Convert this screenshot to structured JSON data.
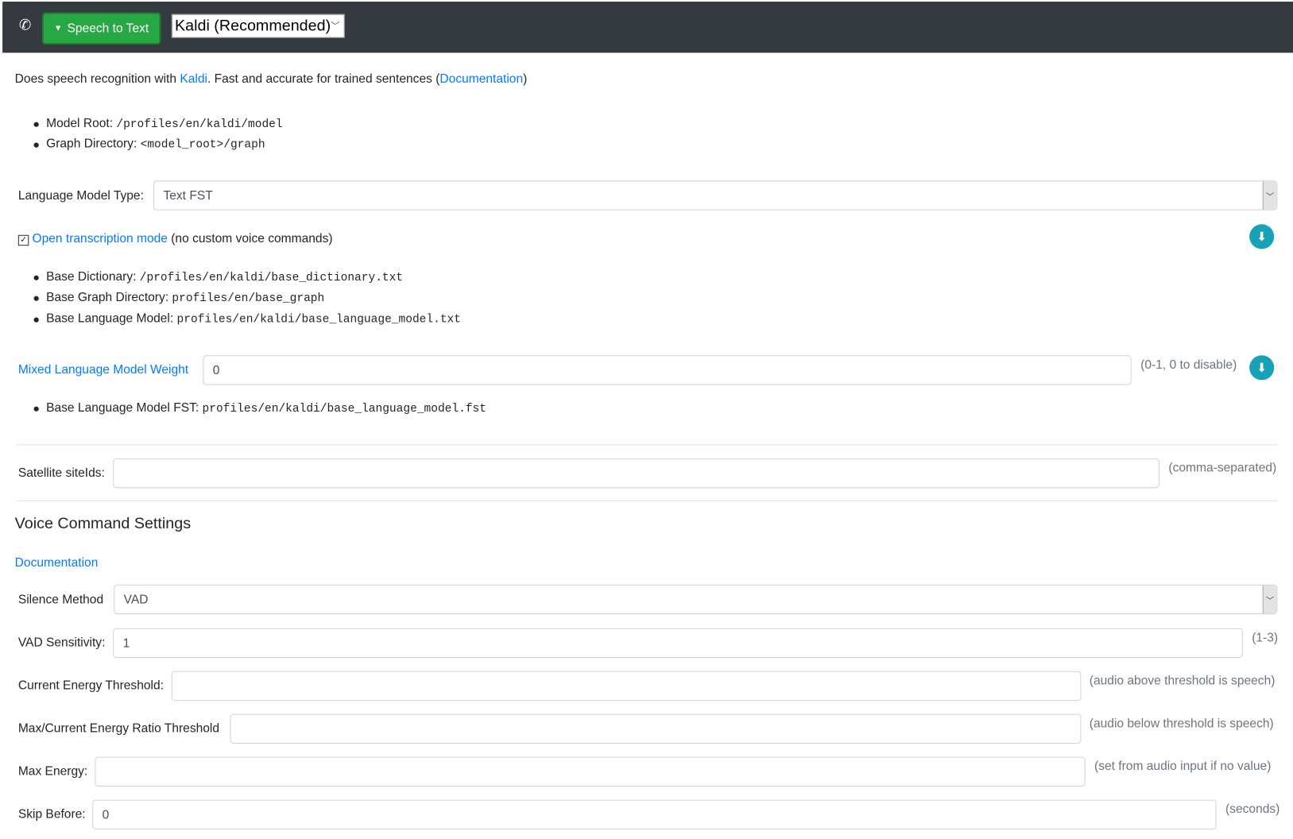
{
  "header": {
    "engine_category": "Speech to Text",
    "engine_selected": "Kaldi (Recommended)"
  },
  "intro": {
    "prefix": "Does speech recognition with ",
    "link": "Kaldi",
    "middle": ". Fast and accurate for trained sentences (",
    "doc_link": "Documentation",
    "suffix": ")"
  },
  "paths": [
    {
      "label": "Model Root: ",
      "value": "/profiles/en/kaldi/model"
    },
    {
      "label": "Graph Directory: ",
      "value": "<model_root>/graph"
    }
  ],
  "lm_type": {
    "label": "Language Model Type:",
    "value": "Text FST"
  },
  "open_transcription": {
    "checked": true,
    "link": "Open transcription mode",
    "suffix": " (no custom voice commands)"
  },
  "base_paths": [
    {
      "label": "Base Dictionary: ",
      "value": "/profiles/en/kaldi/base_dictionary.txt"
    },
    {
      "label": "Base Graph Directory: ",
      "value": "profiles/en/base_graph"
    },
    {
      "label": "Base Language Model: ",
      "value": "profiles/en/kaldi/base_language_model.txt"
    }
  ],
  "mixed_weight": {
    "label": "Mixed Language Model Weight",
    "value": "0",
    "hint": "(0-1, 0 to disable)"
  },
  "base_fst": {
    "label": "Base Language Model FST: ",
    "value": "profiles/en/kaldi/base_language_model.fst"
  },
  "satellite": {
    "label": "Satellite siteIds:",
    "value": "",
    "hint": "(comma-separated)"
  },
  "voice": {
    "heading": "Voice Command Settings",
    "doc_link": "Documentation",
    "silence_method": {
      "label": "Silence Method",
      "value": "VAD"
    },
    "vad": {
      "label": "VAD Sensitivity:",
      "value": "1",
      "hint": "(1-3)"
    },
    "current_energy": {
      "label": "Current Energy Threshold:",
      "value": "",
      "hint": "(audio above threshold is speech)"
    },
    "ratio": {
      "label": "Max/Current Energy Ratio Threshold",
      "value": "",
      "hint": "(audio below threshold is speech)"
    },
    "max_energy": {
      "label": "Max Energy:",
      "value": "",
      "hint": "(set from audio input if no value)"
    },
    "skip_before": {
      "label": "Skip Before:",
      "value": "0",
      "hint": "(seconds)"
    }
  }
}
